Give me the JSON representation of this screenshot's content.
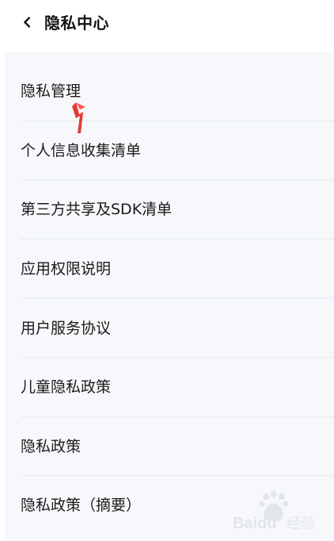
{
  "header": {
    "title": "隐私中心",
    "back_icon": "chevron-left-icon"
  },
  "menu": {
    "items": [
      {
        "label": "隐私管理"
      },
      {
        "label": "个人信息收集清单"
      },
      {
        "label": "第三方共享及SDK清单"
      },
      {
        "label": "应用权限说明"
      },
      {
        "label": "用户服务协议"
      },
      {
        "label": "儿童隐私政策"
      },
      {
        "label": "隐私政策"
      },
      {
        "label": "隐私政策（摘要）"
      }
    ]
  },
  "annotation": {
    "arrow_icon": "red-arrow-icon",
    "arrow_color": "#e53935"
  },
  "watermark": {
    "brand": "Baidu",
    "text": "经验"
  },
  "colors": {
    "background": "#f6f8fb",
    "header": "#ffffff",
    "text": "#1b1b1b",
    "divider": "#e7ebf0"
  }
}
